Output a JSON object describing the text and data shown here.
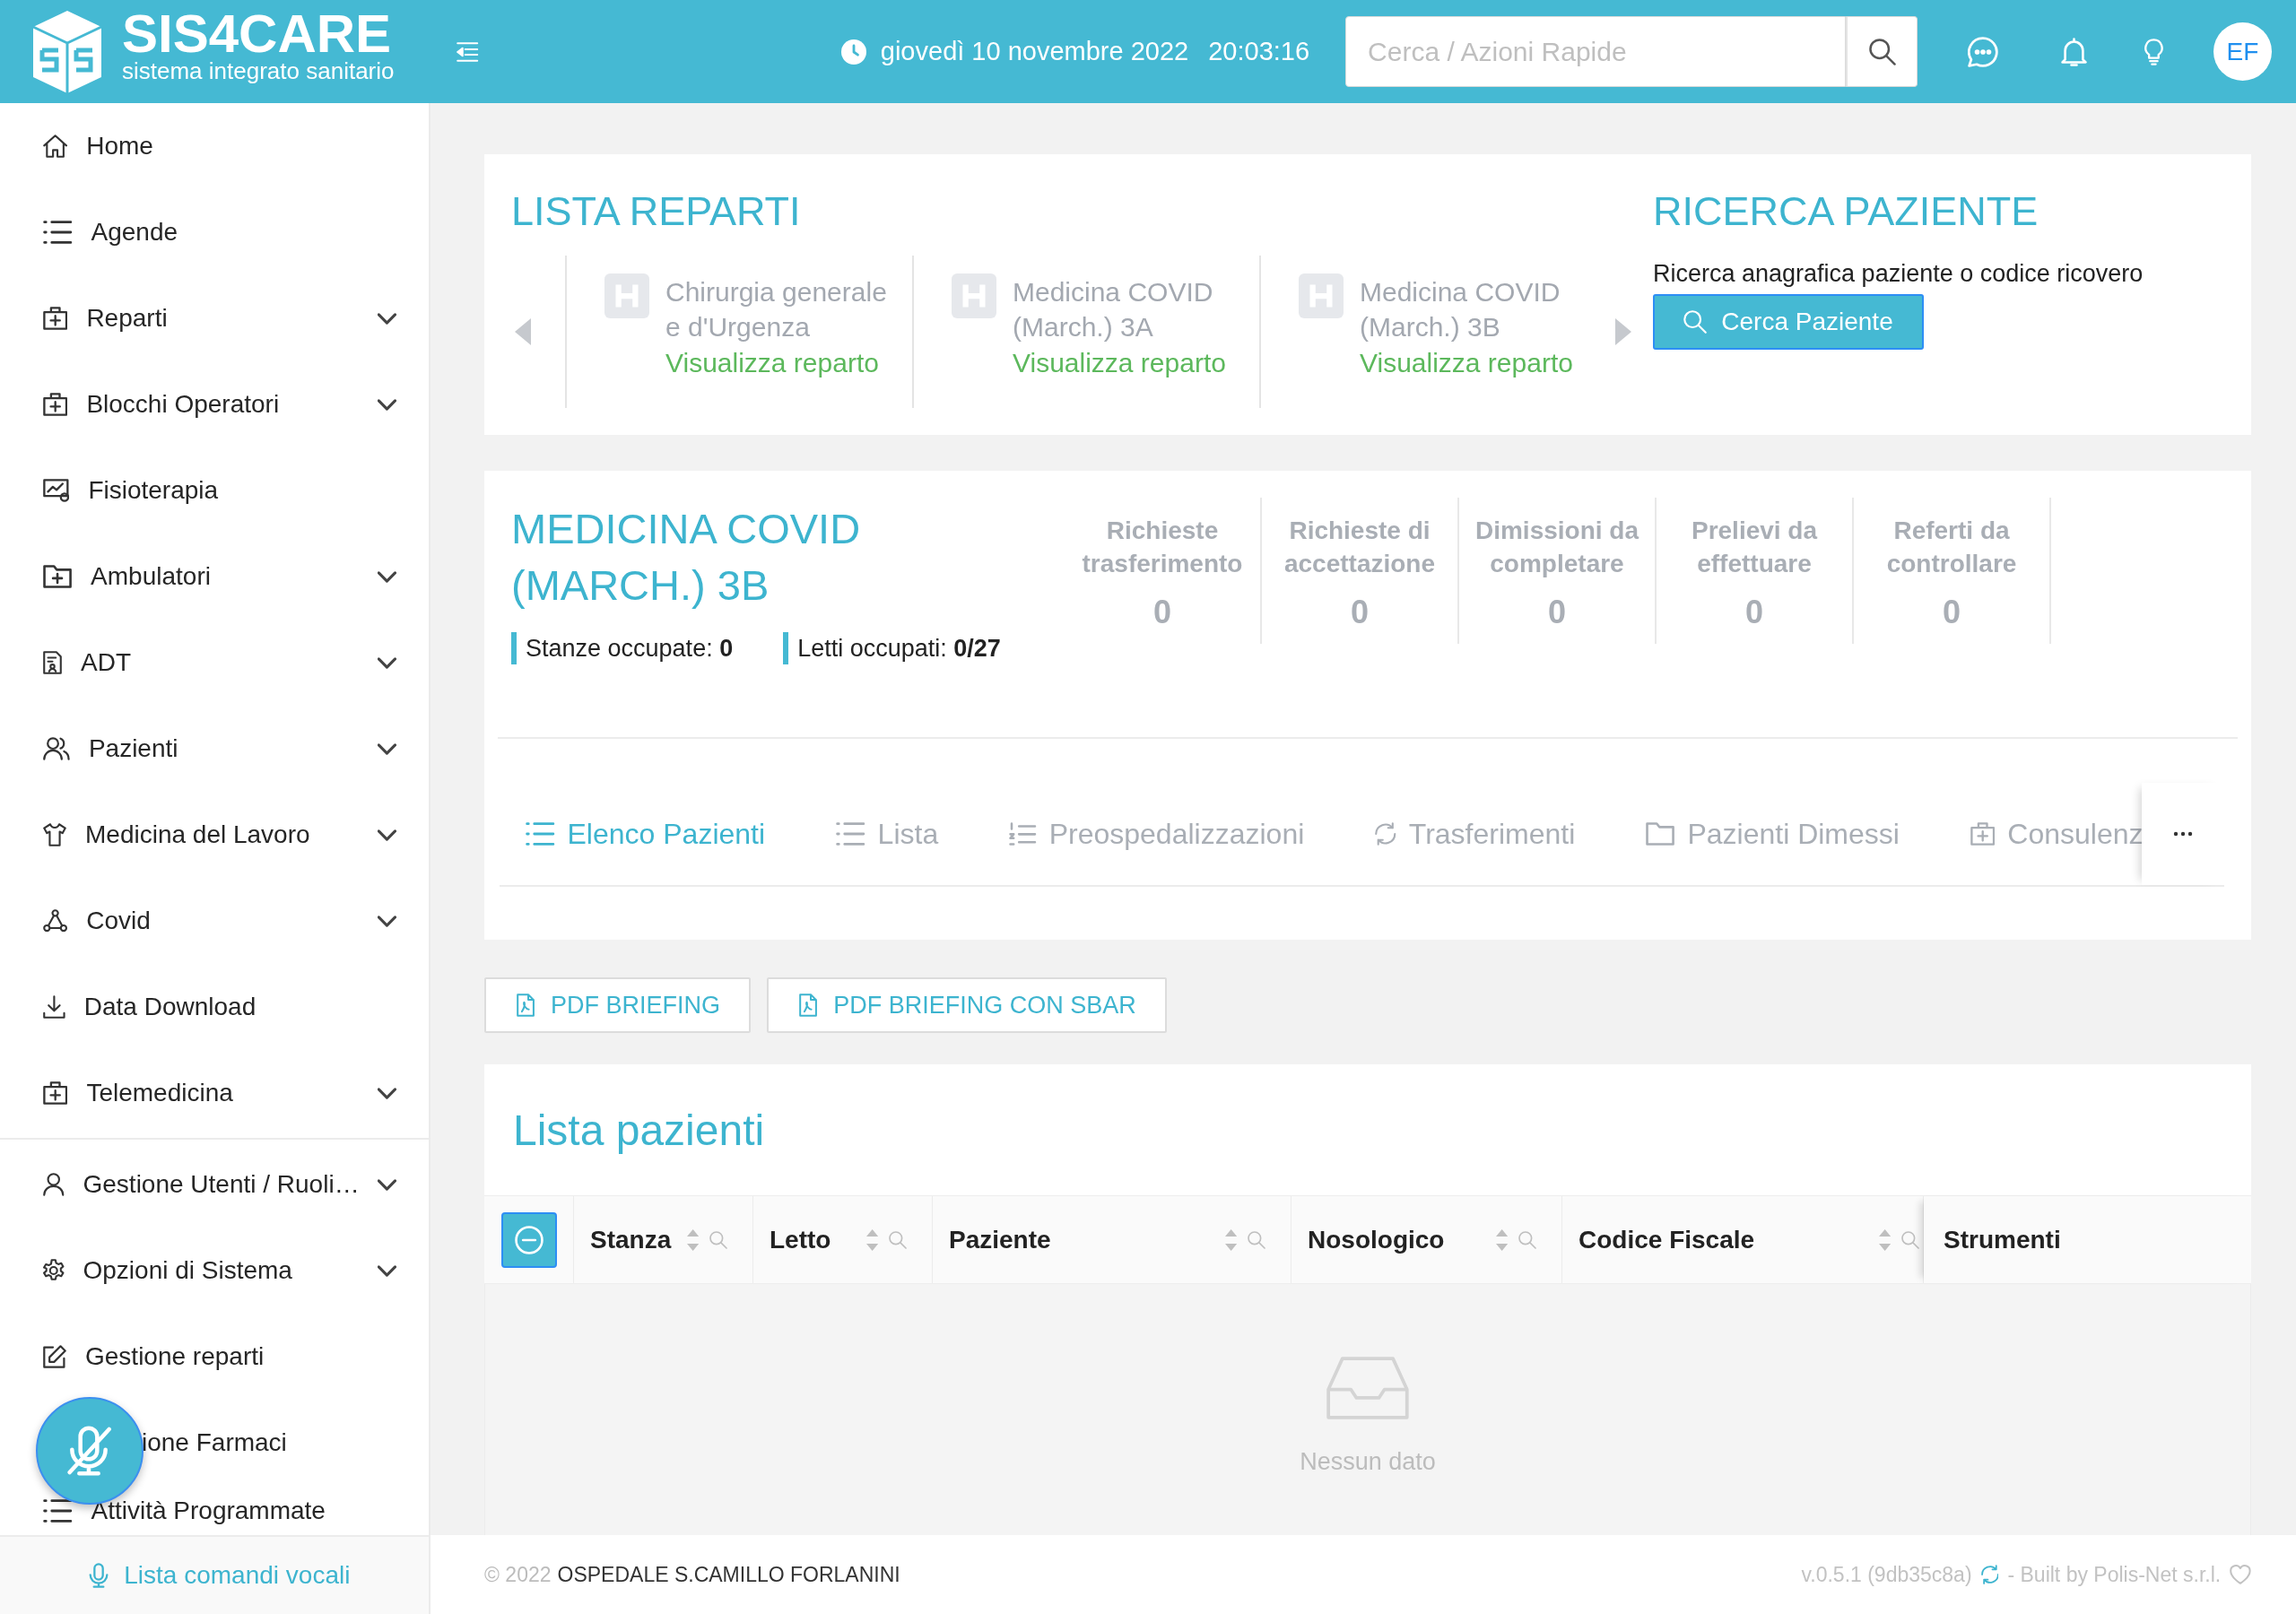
{
  "header": {
    "logo": {
      "title": "SIS4CARE",
      "subtitle": "sistema integrato sanitario"
    },
    "date": "giovedì 10 novembre 2022",
    "time": "20:03:16",
    "search": {
      "placeholder": "Cerca / Azioni Rapide"
    },
    "avatar": "EF"
  },
  "sidebar": {
    "groups": [
      {
        "items": [
          {
            "label": "Home",
            "kind": "link"
          },
          {
            "label": "Agende",
            "kind": "link"
          },
          {
            "label": "Reparti",
            "kind": "submenu"
          },
          {
            "label": "Blocchi Operatori",
            "kind": "submenu"
          },
          {
            "label": "Fisioterapia",
            "kind": "link"
          },
          {
            "label": "Ambulatori",
            "kind": "submenu"
          },
          {
            "label": "ADT",
            "kind": "submenu"
          },
          {
            "label": "Pazienti",
            "kind": "submenu"
          },
          {
            "label": "Medicina del Lavoro",
            "kind": "submenu"
          },
          {
            "label": "Covid",
            "kind": "submenu"
          },
          {
            "label": "Data Download",
            "kind": "link"
          },
          {
            "label": "Telemedicina",
            "kind": "submenu"
          }
        ]
      },
      {
        "items": [
          {
            "label": "Gestione Utenti / Ruoli…",
            "kind": "submenu"
          },
          {
            "label": "Opzioni di Sistema",
            "kind": "submenu"
          },
          {
            "label": "Gestione reparti",
            "kind": "link"
          },
          {
            "label": "ione Farmaci",
            "kind": "partial"
          },
          {
            "label": "Attività Programmate",
            "kind": "link"
          }
        ]
      }
    ],
    "voice_button": {
      "muted": true
    },
    "voice_commands": "Lista comandi vocali"
  },
  "reparti": {
    "title": "LISTA REPARTI",
    "items": [
      {
        "name": "Chirurgia generale e d'Urgenza",
        "link": "Visualizza reparto"
      },
      {
        "name": "Medicina COVID (March.) 3A",
        "link": "Visualizza reparto"
      },
      {
        "name": "Medicina COVID (March.) 3B",
        "link": "Visualizza reparto"
      }
    ]
  },
  "patient_search": {
    "title": "RICERCA PAZIENTE",
    "description": "Ricerca anagrafica paziente o codice ricovero",
    "button": "Cerca Paziente"
  },
  "department": {
    "title": "MEDICINA COVID (MARCH.) 3B",
    "occupancy": [
      "Stanze occupate: **0**",
      "Letti occupati: **0/27**"
    ],
    "stats": [
      {
        "label": "Richieste trasferimento",
        "value": "0"
      },
      {
        "label": "Richieste di accettazione",
        "value": "0"
      },
      {
        "label": "Dimissioni da completare",
        "value": "0"
      },
      {
        "label": "Prelievi da effettuare",
        "value": "0"
      },
      {
        "label": "Referti da controllare",
        "value": "0"
      }
    ],
    "tabs": [
      {
        "label": "Elenco Pazienti",
        "selected": true
      },
      {
        "label": "Lista",
        "selected": false
      },
      {
        "label": "Preospedalizzazioni",
        "selected": false
      },
      {
        "label": "Trasferimenti",
        "selected": false
      },
      {
        "label": "Pazienti Dimessi",
        "selected": false
      },
      {
        "label": "Consulenz",
        "selected": false
      }
    ]
  },
  "actions": [
    {
      "label": "PDF BRIEFING"
    },
    {
      "label": "PDF BRIEFING CON SBAR"
    }
  ],
  "patients": {
    "title": "Lista pazienti",
    "columns": [
      {
        "label": "Stanza",
        "kind": "sortable"
      },
      {
        "label": "Letto",
        "kind": "sortable"
      },
      {
        "label": "Paziente",
        "kind": "sortable"
      },
      {
        "label": "Nosologico",
        "kind": "sortable"
      },
      {
        "label": "Codice Fiscale",
        "kind": "sortable"
      },
      {
        "label": "Strumenti",
        "kind": "fixed"
      }
    ],
    "empty_text": "Nessun dato"
  },
  "footer": {
    "copyright": "© 2022",
    "hospital": "OSPEDALE S.CAMILLO FORLANINI",
    "version": "v.0.5.1 (9db35c8a)",
    "credits": "- Built by Polis-Net s.r.l."
  }
}
